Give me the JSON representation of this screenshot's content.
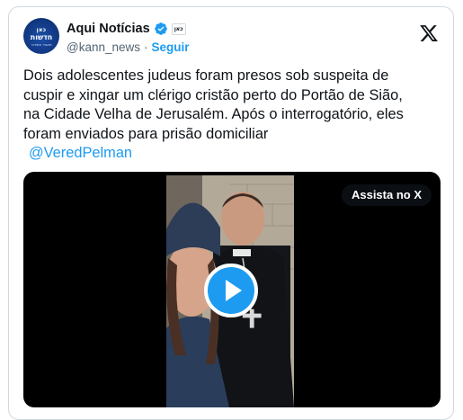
{
  "account": {
    "name": "Aqui Notícias",
    "handle": "@kann_news",
    "separator": "·",
    "follow_label": "Seguir",
    "affiliate_badge_text": "כאן",
    "avatar_logo_top": "כאן",
    "avatar_logo_mid": "חדשות",
    "avatar_logo_bot": "תאגיד השידור"
  },
  "tweet": {
    "lines": [
      "Dois adolescentes judeus foram presos sob suspeita de",
      "cuspir e xingar um clérigo cristão perto do Portão de Sião,",
      "na Cidade Velha de Jerusalém. Após o interrogatório, eles",
      "foram enviados para prisão domiciliar"
    ],
    "mention": "@VeredPelman"
  },
  "media": {
    "watch_label": "Assista no X"
  },
  "colors": {
    "accent": "#1d9bf0",
    "text": "#0f1419",
    "secondary_text": "#536471",
    "border": "#cfd9de"
  },
  "icons": {
    "verified": "verified-badge-icon",
    "x_logo": "x-logo-icon",
    "play": "play-icon"
  }
}
